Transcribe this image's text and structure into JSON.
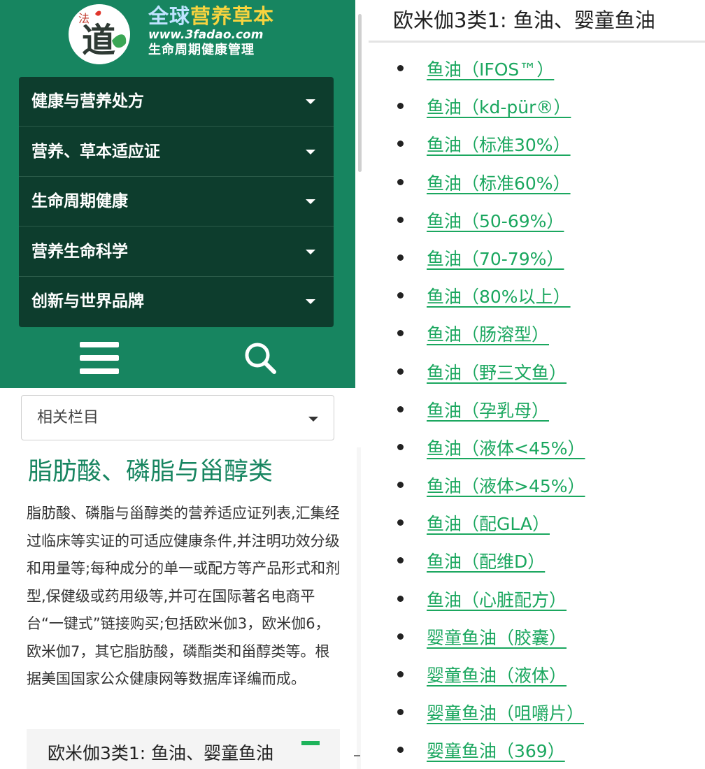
{
  "logo": {
    "badge_char": "法",
    "main_char": "道",
    "title_part1": "全球",
    "title_part2": "营养草本",
    "url": "www.3fadao.com",
    "subtitle": "生命周期健康管理"
  },
  "nav_menu": [
    {
      "label": "健康与营养处方"
    },
    {
      "label": "营养、草本适应证"
    },
    {
      "label": "生命周期健康"
    },
    {
      "label": "营养生命科学"
    },
    {
      "label": "创新与世界品牌"
    }
  ],
  "icons": {
    "menu": "hamburger-icon",
    "search": "search-icon",
    "dropdown": "caret-down-icon"
  },
  "related_select": {
    "value": "相关栏目"
  },
  "section": {
    "title": "脂肪酸、磷脂与甾醇类",
    "description": "脂肪酸、磷脂与甾醇类的营养适应证列表,汇集经过临床等实证的可适应健康条件,并注明功效分级和用量等;每种成分的单一或配方等产品形式和剂型,保健级或药用级等,并可在国际著名电商平台“一键式”链接购买;包括欧米伽3，欧米伽6，欧米伽7，其它脂肪酸，磷酯类和甾醇类等。根据美国国家公众健康网等数据库译编而成。"
  },
  "category_box": {
    "title": "欧米伽3类1: 鱼油、婴童鱼油"
  },
  "right_panel": {
    "title": "欧米伽3类1: 鱼油、婴童鱼油",
    "items": [
      "鱼油（IFOS™）",
      "鱼油（kd-pür®）",
      "鱼油（标准30%）",
      "鱼油（标准60%）",
      "鱼油（50-69%）",
      "鱼油（70-79%）",
      "鱼油（80%以上）",
      "鱼油（肠溶型）",
      "鱼油（野三文鱼）",
      "鱼油（孕乳母）",
      "鱼油（液体<45%）",
      "鱼油（液体>45%）",
      "鱼油（配GLA）",
      "鱼油（配维D）",
      "鱼油（心脏配方）",
      "婴童鱼油（胶囊）",
      "婴童鱼油（液体）",
      "婴童鱼油（咀嚼片）",
      "婴童鱼油（369）"
    ]
  },
  "colors": {
    "header_green": "#178560",
    "menu_dark": "#0d3d2d",
    "link_green": "#1ba75f",
    "accent_green": "#1db35a"
  }
}
